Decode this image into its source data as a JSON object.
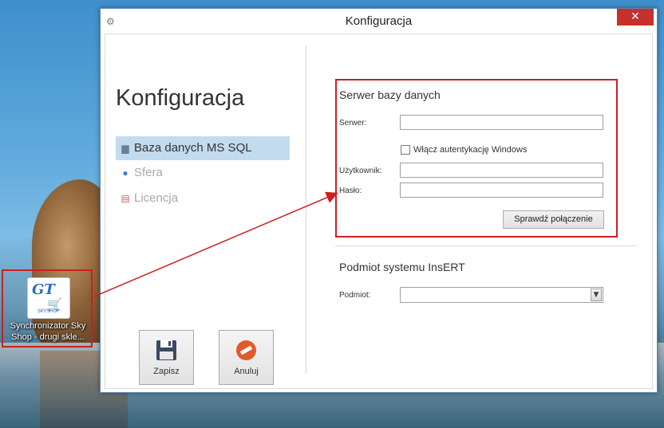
{
  "desktop": {
    "icon_label": "Synchronizator Sky Shop - drugi skle...",
    "icon_logo_text": "GT",
    "icon_logo_subtext": "SKYSHOP"
  },
  "window": {
    "title": "Konfiguracja",
    "close_glyph": "✕",
    "app_icon": "settings-icon"
  },
  "sidebar": {
    "heading": "Konfiguracja",
    "items": [
      {
        "label": "Baza danych MS SQL",
        "icon": "database-icon",
        "active": true
      },
      {
        "label": "Sfera",
        "icon": "globe-icon",
        "active": false
      },
      {
        "label": "Licencja",
        "icon": "license-icon",
        "active": false
      }
    ]
  },
  "actions": {
    "save_label": "Zapisz",
    "cancel_label": "Anuluj"
  },
  "db_server": {
    "section_title": "Serwer bazy danych",
    "server_label": "Serwer:",
    "server_value": "",
    "windows_auth_label": "Włącz autentykację Windows",
    "windows_auth_checked": false,
    "user_label": "Użytkownik:",
    "user_value": "",
    "password_label": "Hasło:",
    "password_value": "",
    "test_button_label": "Sprawdź połączenie"
  },
  "insert": {
    "section_title": "Podmiot systemu InsERT",
    "entity_label": "Podmiot:",
    "entity_value": ""
  },
  "colors": {
    "highlight_red": "#cc1f1f",
    "active_nav_bg": "#c3dbef",
    "close_red": "#c7312c"
  }
}
